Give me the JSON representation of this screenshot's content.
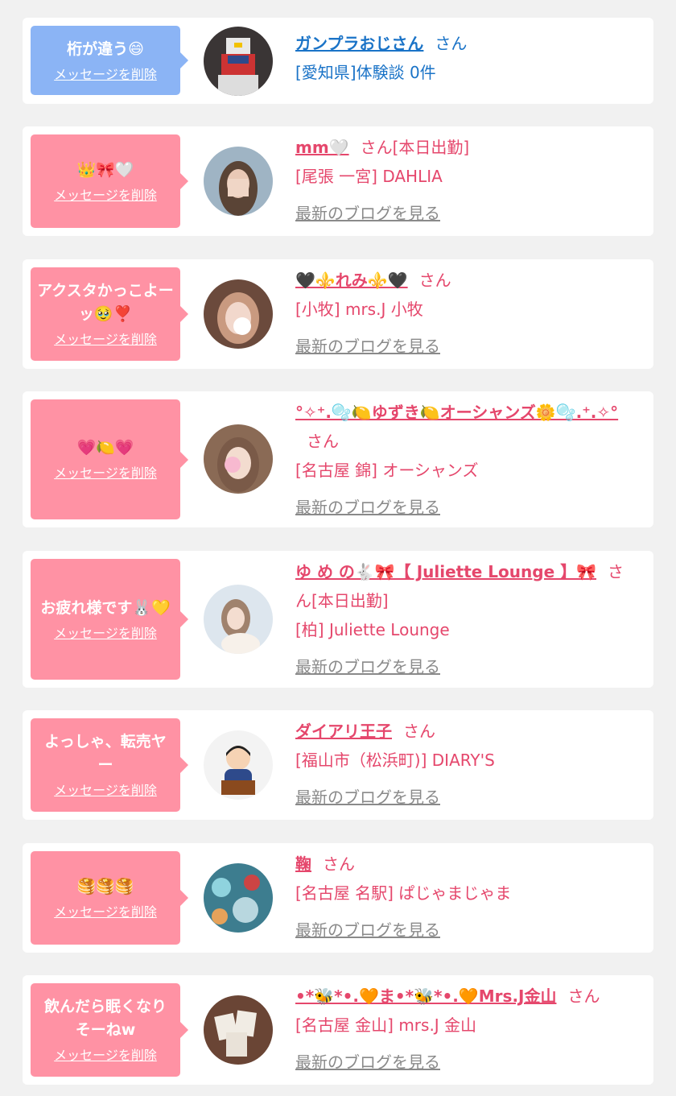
{
  "delete_label": "メッセージを削除",
  "blog_label": "最新のブログを見る",
  "items": [
    {
      "message": "桁が違う😄",
      "name": "ガンプラおじさん",
      "suffix": "さん",
      "location": "[愛知県]体験談 0件"
    },
    {
      "message": "👑🎀🤍",
      "name": "mm🤍",
      "suffix": "さん[本日出勤]",
      "location": "[尾張 一宮] DAHLIA"
    },
    {
      "message": "アクスタかっこよーッ🥹❣️",
      "name": "🖤⚜️れみ⚜️🖤",
      "suffix": "さん",
      "location": "[小牧] mrs.J 小牧"
    },
    {
      "message": "💗🍋💗",
      "name": "°✧⁺.🫧🍋ゆずき🍋オーシャンズ🌼🫧.⁺.✧°",
      "suffix": "さん",
      "location": "[名古屋 錦] オーシャンズ"
    },
    {
      "message": "お疲れ様です🐰💛",
      "name": "ゆ め の🐇🎀【 Juliette Lounge 】🎀",
      "suffix": "さん[本日出勤]",
      "location": "[柏] Juliette Lounge"
    },
    {
      "message": "よっしゃ、転売ヤー",
      "name": "ダイアリ王子",
      "suffix": "さん",
      "location": "[福山市（松浜町)] DIARY'S"
    },
    {
      "message": "🥞🥞🥞",
      "name": "鞠",
      "suffix": "さん",
      "location": "[名古屋 名駅] ぱじゃまじゃま"
    },
    {
      "message": "飲んだら眠くなりそーねw",
      "name": "•*🐝*•.🧡ま•*🐝*•.🧡Mrs.J金山",
      "suffix": "さん",
      "location": "[名古屋 金山] mrs.J 金山"
    }
  ]
}
